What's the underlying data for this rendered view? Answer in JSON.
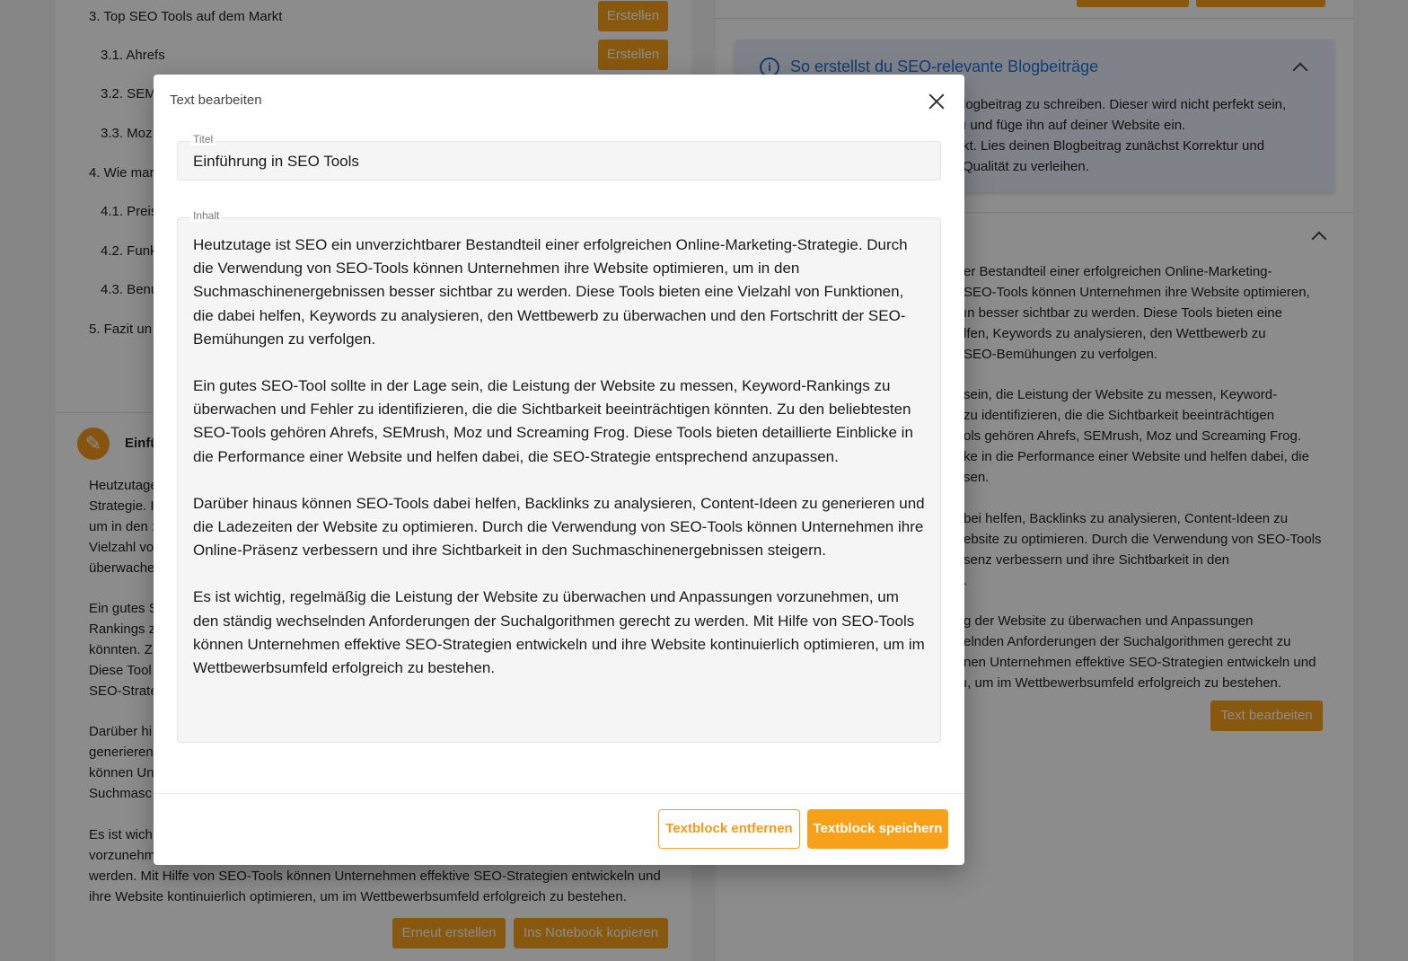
{
  "outline": [
    {
      "label": "3. Top SEO Tools auf dem Markt",
      "button": "Erstellen"
    },
    {
      "label": "3.1. Ahrefs",
      "button": "Erstellen"
    },
    {
      "label": "3.2. SEM"
    },
    {
      "label": "3.3. Moz"
    },
    {
      "label": "4. Wie mar"
    },
    {
      "label": "4.1. Preis"
    },
    {
      "label": "4.2. Funk"
    },
    {
      "label": "4.3. Benu"
    },
    {
      "label": "5. Fazit un"
    }
  ],
  "left_card": {
    "title": "Einfü",
    "paragraphs": [
      "Heutzutage\nStrategie. I\num in den :\nVielzahl vo\nüberwache",
      "Ein gutes S\nRankings z\nkönnten. Z\nDiese Tool\nSEO-Strate",
      "Darüber hi\ngenerieren\nkönnen Un\nSuchmasc",
      "Es ist wich\nvorzunehm\nwerden. Mit Hilfe von SEO-Tools können Unternehmen effektive SEO-Strategien entwickeln und\nihre Website kontinuierlich optimieren, um im Wettbewerbsumfeld erfolgreich zu bestehen."
    ],
    "btn_regenerate": "Erneut erstellen",
    "btn_copy": "Ins Notebook kopieren"
  },
  "right_panel": {
    "info_title": "So erstellst du SEO-relevante Blogbeiträge",
    "info_text": "logbeitrag zu schreiben. Dieser wird nicht perfekt sein,\nı und füge ihn auf deiner Website ein.\nkt. Lies deinen Blogbeitrag zunächst Korrektur und\nQualität zu verleihen.",
    "paragraphs": [
      "er Bestandteil einer erfolgreichen Online-Marketing-\n SEO-Tools können Unternehmen ihre Website optimieren,\nın besser sichtbar zu werden. Diese Tools bieten eine\nlfen, Keywords zu analysieren, den Wettbewerb zu\nSEO-Bemühungen zu verfolgen.",
      "sein, die Leistung der Website zu messen, Keyword-\nzu identifizieren, die die Sichtbarkeit beeinträchtigen\nols gehören Ahrefs, SEMrush, Moz und Screaming Frog.\nke in die Performance einer Website und helfen dabei, die\nsen.",
      "bei helfen, Backlinks zu analysieren, Content-Ideen zu\nebsite zu optimieren. Durch die Verwendung von SEO-Tools\nsenz verbessern und ihre Sichtbarkeit in den\n.",
      "g der Website zu überwachen und Anpassungen\nelnden Anforderungen der Suchalgorithmen gerecht zu\nnen Unternehmen effektive SEO-Strategien entwickeln und\nı, um im Wettbewerbsumfeld erfolgreich zu bestehen."
    ],
    "btn_edit": "Text bearbeiten"
  },
  "modal": {
    "title": "Text bearbeiten",
    "title_label": "Titel",
    "title_value": "Einführung in SEO Tools",
    "content_label": "Inhalt",
    "content_paragraphs": [
      "Heutzutage ist SEO ein unverzichtbarer Bestandteil einer erfolgreichen Online-Marketing-Strategie. Durch die Verwendung von SEO-Tools können Unternehmen ihre Website optimieren, um in den Suchmaschinenergebnissen besser sichtbar zu werden. Diese Tools bieten eine Vielzahl von Funktionen, die dabei helfen, Keywords zu analysieren, den Wettbewerb zu überwachen und den Fortschritt der SEO-Bemühungen zu verfolgen.",
      "Ein gutes SEO-Tool sollte in der Lage sein, die Leistung der Website zu messen, Keyword-Rankings zu überwachen und Fehler zu identifizieren, die die Sichtbarkeit beeinträchtigen könnten. Zu den beliebtesten SEO-Tools gehören Ahrefs, SEMrush, Moz und Screaming Frog. Diese Tools bieten detaillierte Einblicke in die Performance einer Website und helfen dabei, die SEO-Strategie entsprechend anzupassen.",
      "Darüber hinaus können SEO-Tools dabei helfen, Backlinks zu analysieren, Content-Ideen zu generieren und die Ladezeiten der Website zu optimieren. Durch die Verwendung von SEO-Tools können Unternehmen ihre Online-Präsenz verbessern und ihre Sichtbarkeit in den Suchmaschinenergebnissen steigern.",
      "Es ist wichtig, regelmäßig die Leistung der Website zu überwachen und Anpassungen vorzunehmen, um den ständig wechselnden Anforderungen der Suchalgorithmen gerecht zu werden. Mit Hilfe von SEO-Tools können Unternehmen effektive SEO-Strategien entwickeln und ihre Website kontinuierlich optimieren, um im Wettbewerbsumfeld erfolgreich zu bestehen."
    ],
    "btn_remove": "Textblock entfernen",
    "btn_save": "Textblock speichern"
  },
  "colors": {
    "accent": "#f7a11a",
    "info_blue": "#1f6fd1"
  }
}
